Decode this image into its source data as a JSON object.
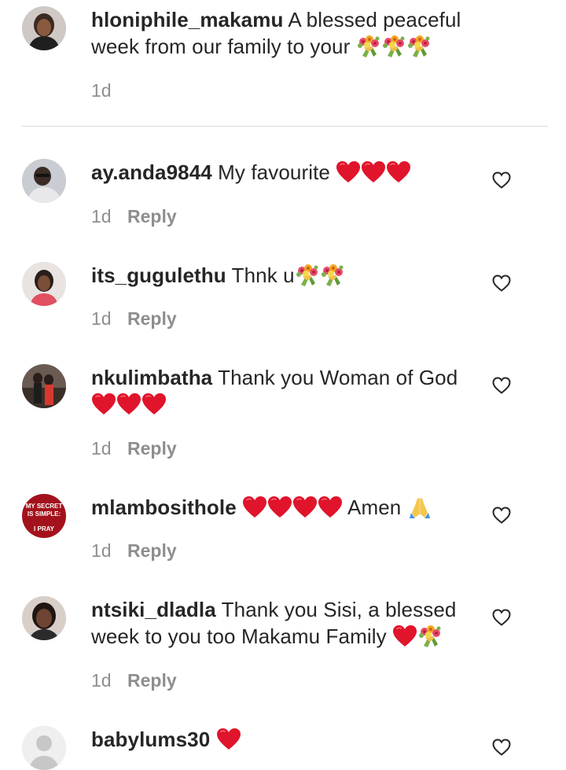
{
  "caption": {
    "username": "hloniphile_makamu",
    "text": "A blessed peaceful week from our family to your",
    "emojis": [
      "bouquet",
      "bouquet",
      "bouquet"
    ],
    "time": "1d"
  },
  "comments": [
    {
      "username": "ay.anda9844",
      "text": "My favourite",
      "emojis_after": [
        "red-heart",
        "red-heart",
        "red-heart"
      ],
      "time": "1d",
      "reply_label": "Reply"
    },
    {
      "username": "its_gugulethu",
      "text": "Thnk u",
      "emojis_after": [
        "bouquet",
        "bouquet"
      ],
      "time": "1d",
      "reply_label": "Reply"
    },
    {
      "username": "nkulimbatha",
      "text": "Thank you Woman of God",
      "emojis_after": [
        "red-heart",
        "red-heart",
        "red-heart"
      ],
      "time": "1d",
      "reply_label": "Reply"
    },
    {
      "username": "mlambosithole",
      "text_after_emojis": "Amen",
      "emojis_before": [
        "red-heart",
        "red-heart",
        "red-heart",
        "red-heart"
      ],
      "emojis_after": [
        "folded-hands"
      ],
      "avatar_text": [
        "MY SECRET",
        "IS SIMPLE:",
        "I PRAY"
      ],
      "time": "1d",
      "reply_label": "Reply"
    },
    {
      "username": "ntsiki_dladla",
      "text": "Thank you Sisi, a blessed week to you too Makamu Family",
      "emojis_after": [
        "red-heart",
        "bouquet"
      ],
      "time": "1d",
      "reply_label": "Reply"
    },
    {
      "username": "babylums30",
      "text": "",
      "emojis_after": [
        "red-heart"
      ]
    }
  ],
  "icons": {
    "like": "heart-outline-icon",
    "avatar_placeholder": "default-avatar-icon"
  },
  "colors": {
    "text": "#262626",
    "secondary": "#8e8e8e",
    "divider": "#dbdbdb",
    "heart_emoji": "#e0142a"
  }
}
